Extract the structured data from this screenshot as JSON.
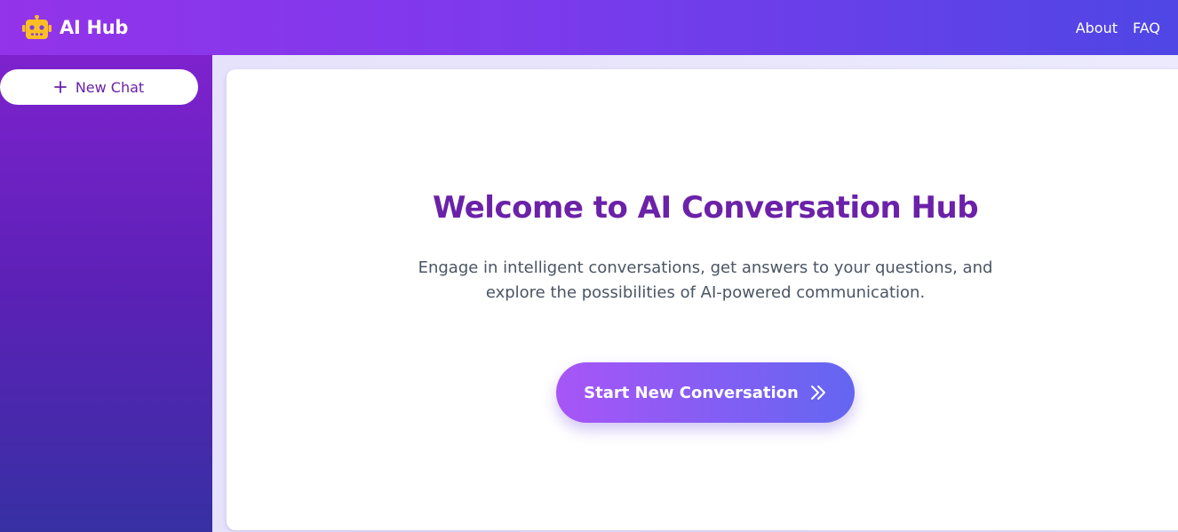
{
  "header": {
    "brand_icon": "robot-icon",
    "title": "AI Hub",
    "nav": [
      {
        "label": "About"
      },
      {
        "label": "FAQ"
      }
    ]
  },
  "sidebar": {
    "new_chat_icon": "plus-icon",
    "new_chat_label": "New Chat"
  },
  "main": {
    "heading": "Welcome to AI Conversation Hub",
    "description": "Engage in intelligent conversations, get answers to your questions, and explore the possibilities of AI-powered communication.",
    "cta_label": "Start New Conversation",
    "cta_icon": "double-chevron-right-icon"
  },
  "colors": {
    "header_gradient_start": "#9333ea",
    "header_gradient_end": "#4f46e5",
    "sidebar_gradient_start": "#7e22ce",
    "sidebar_gradient_end": "#3730a3",
    "heading_color": "#6b21a8",
    "robot_icon": "#fbbf24",
    "cta_gradient_start": "#a855f7",
    "cta_gradient_end": "#6366f1"
  }
}
